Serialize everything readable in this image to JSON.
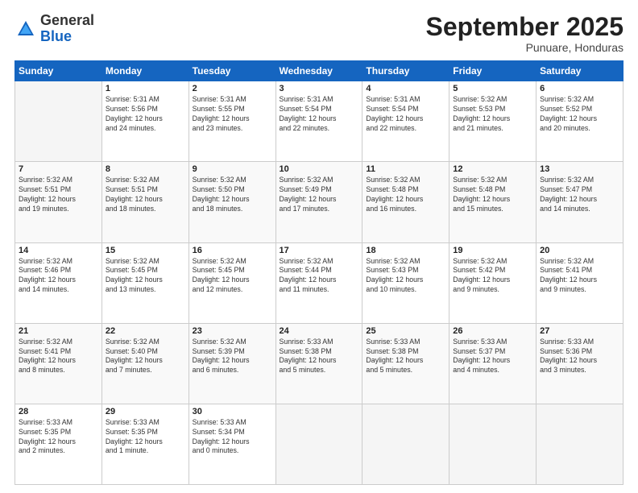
{
  "header": {
    "logo_general": "General",
    "logo_blue": "Blue",
    "month_title": "September 2025",
    "subtitle": "Punuare, Honduras"
  },
  "weekdays": [
    "Sunday",
    "Monday",
    "Tuesday",
    "Wednesday",
    "Thursday",
    "Friday",
    "Saturday"
  ],
  "weeks": [
    [
      {
        "day": "",
        "info": ""
      },
      {
        "day": "1",
        "info": "Sunrise: 5:31 AM\nSunset: 5:56 PM\nDaylight: 12 hours\nand 24 minutes."
      },
      {
        "day": "2",
        "info": "Sunrise: 5:31 AM\nSunset: 5:55 PM\nDaylight: 12 hours\nand 23 minutes."
      },
      {
        "day": "3",
        "info": "Sunrise: 5:31 AM\nSunset: 5:54 PM\nDaylight: 12 hours\nand 22 minutes."
      },
      {
        "day": "4",
        "info": "Sunrise: 5:31 AM\nSunset: 5:54 PM\nDaylight: 12 hours\nand 22 minutes."
      },
      {
        "day": "5",
        "info": "Sunrise: 5:32 AM\nSunset: 5:53 PM\nDaylight: 12 hours\nand 21 minutes."
      },
      {
        "day": "6",
        "info": "Sunrise: 5:32 AM\nSunset: 5:52 PM\nDaylight: 12 hours\nand 20 minutes."
      }
    ],
    [
      {
        "day": "7",
        "info": "Sunrise: 5:32 AM\nSunset: 5:51 PM\nDaylight: 12 hours\nand 19 minutes."
      },
      {
        "day": "8",
        "info": "Sunrise: 5:32 AM\nSunset: 5:51 PM\nDaylight: 12 hours\nand 18 minutes."
      },
      {
        "day": "9",
        "info": "Sunrise: 5:32 AM\nSunset: 5:50 PM\nDaylight: 12 hours\nand 18 minutes."
      },
      {
        "day": "10",
        "info": "Sunrise: 5:32 AM\nSunset: 5:49 PM\nDaylight: 12 hours\nand 17 minutes."
      },
      {
        "day": "11",
        "info": "Sunrise: 5:32 AM\nSunset: 5:48 PM\nDaylight: 12 hours\nand 16 minutes."
      },
      {
        "day": "12",
        "info": "Sunrise: 5:32 AM\nSunset: 5:48 PM\nDaylight: 12 hours\nand 15 minutes."
      },
      {
        "day": "13",
        "info": "Sunrise: 5:32 AM\nSunset: 5:47 PM\nDaylight: 12 hours\nand 14 minutes."
      }
    ],
    [
      {
        "day": "14",
        "info": "Sunrise: 5:32 AM\nSunset: 5:46 PM\nDaylight: 12 hours\nand 14 minutes."
      },
      {
        "day": "15",
        "info": "Sunrise: 5:32 AM\nSunset: 5:45 PM\nDaylight: 12 hours\nand 13 minutes."
      },
      {
        "day": "16",
        "info": "Sunrise: 5:32 AM\nSunset: 5:45 PM\nDaylight: 12 hours\nand 12 minutes."
      },
      {
        "day": "17",
        "info": "Sunrise: 5:32 AM\nSunset: 5:44 PM\nDaylight: 12 hours\nand 11 minutes."
      },
      {
        "day": "18",
        "info": "Sunrise: 5:32 AM\nSunset: 5:43 PM\nDaylight: 12 hours\nand 10 minutes."
      },
      {
        "day": "19",
        "info": "Sunrise: 5:32 AM\nSunset: 5:42 PM\nDaylight: 12 hours\nand 9 minutes."
      },
      {
        "day": "20",
        "info": "Sunrise: 5:32 AM\nSunset: 5:41 PM\nDaylight: 12 hours\nand 9 minutes."
      }
    ],
    [
      {
        "day": "21",
        "info": "Sunrise: 5:32 AM\nSunset: 5:41 PM\nDaylight: 12 hours\nand 8 minutes."
      },
      {
        "day": "22",
        "info": "Sunrise: 5:32 AM\nSunset: 5:40 PM\nDaylight: 12 hours\nand 7 minutes."
      },
      {
        "day": "23",
        "info": "Sunrise: 5:32 AM\nSunset: 5:39 PM\nDaylight: 12 hours\nand 6 minutes."
      },
      {
        "day": "24",
        "info": "Sunrise: 5:33 AM\nSunset: 5:38 PM\nDaylight: 12 hours\nand 5 minutes."
      },
      {
        "day": "25",
        "info": "Sunrise: 5:33 AM\nSunset: 5:38 PM\nDaylight: 12 hours\nand 5 minutes."
      },
      {
        "day": "26",
        "info": "Sunrise: 5:33 AM\nSunset: 5:37 PM\nDaylight: 12 hours\nand 4 minutes."
      },
      {
        "day": "27",
        "info": "Sunrise: 5:33 AM\nSunset: 5:36 PM\nDaylight: 12 hours\nand 3 minutes."
      }
    ],
    [
      {
        "day": "28",
        "info": "Sunrise: 5:33 AM\nSunset: 5:35 PM\nDaylight: 12 hours\nand 2 minutes."
      },
      {
        "day": "29",
        "info": "Sunrise: 5:33 AM\nSunset: 5:35 PM\nDaylight: 12 hours\nand 1 minute."
      },
      {
        "day": "30",
        "info": "Sunrise: 5:33 AM\nSunset: 5:34 PM\nDaylight: 12 hours\nand 0 minutes."
      },
      {
        "day": "",
        "info": ""
      },
      {
        "day": "",
        "info": ""
      },
      {
        "day": "",
        "info": ""
      },
      {
        "day": "",
        "info": ""
      }
    ]
  ]
}
